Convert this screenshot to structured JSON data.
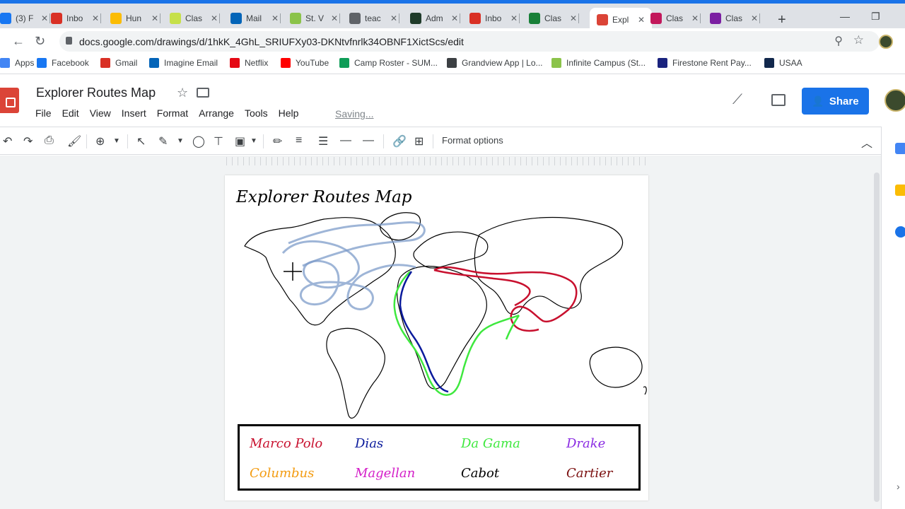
{
  "browser": {
    "tabs": [
      {
        "label": "(3) F",
        "color": "#1877f2"
      },
      {
        "label": "Inbo",
        "color": "#d93025"
      },
      {
        "label": "Hun",
        "color": "#fbbc04"
      },
      {
        "label": "Clas",
        "color": "#c6e04a"
      },
      {
        "label": "Mail",
        "color": "#0364b8"
      },
      {
        "label": "St. V",
        "color": "#8bc34a"
      },
      {
        "label": "teac",
        "color": "#5f6368"
      },
      {
        "label": "Adm",
        "color": "#1f3b2a"
      },
      {
        "label": "Inbo",
        "color": "#d93025"
      },
      {
        "label": "Clas",
        "color": "#188038"
      },
      {
        "label": "Expl",
        "color": "#db4437"
      },
      {
        "label": "Clas",
        "color": "#c2185b"
      },
      {
        "label": "Clas",
        "color": "#7b1fa2"
      }
    ],
    "close_glyph": "✕",
    "new_tab_glyph": "+",
    "url": "docs.google.com/drawings/d/1hkK_4GhL_SRIUFXy03-DKNtvfnrlk34OBNF1XictScs/edit",
    "bookmarks": [
      {
        "label": "Apps",
        "color": "#4285f4"
      },
      {
        "label": "Facebook",
        "color": "#1877f2"
      },
      {
        "label": "Gmail",
        "color": "#d93025"
      },
      {
        "label": "Imagine Email",
        "color": "#0364b8"
      },
      {
        "label": "Netflix",
        "color": "#e50914"
      },
      {
        "label": "YouTube",
        "color": "#ff0000"
      },
      {
        "label": "Camp Roster - SUM...",
        "color": "#0f9d58"
      },
      {
        "label": "Grandview App | Lo...",
        "color": "#3c4043"
      },
      {
        "label": "Infinite Campus (St...",
        "color": "#8bc34a"
      },
      {
        "label": "Firestone Rent Pay...",
        "color": "#1a237e"
      },
      {
        "label": "USAA",
        "color": "#12284c"
      }
    ]
  },
  "docs": {
    "title": "Explorer Routes Map",
    "menu": [
      "File",
      "Edit",
      "View",
      "Insert",
      "Format",
      "Arrange",
      "Tools",
      "Help"
    ],
    "saving": "Saving...",
    "share_label": "Share",
    "format_options": "Format options"
  },
  "drawing": {
    "title": "Explorer Routes Map",
    "legend": [
      {
        "name": "Marco Polo",
        "color": "#c8102e"
      },
      {
        "name": "Dias",
        "color": "#0a1a9c"
      },
      {
        "name": "Da Gama",
        "color": "#3ee83e"
      },
      {
        "name": "Drake",
        "color": "#8a2be2"
      },
      {
        "name": "Columbus",
        "color": "#f39c12"
      },
      {
        "name": "Magellan",
        "color": "#d41fc8"
      },
      {
        "name": "Cabot",
        "color": "#000000"
      },
      {
        "name": "Cartier",
        "color": "#7a0e0e"
      }
    ]
  }
}
